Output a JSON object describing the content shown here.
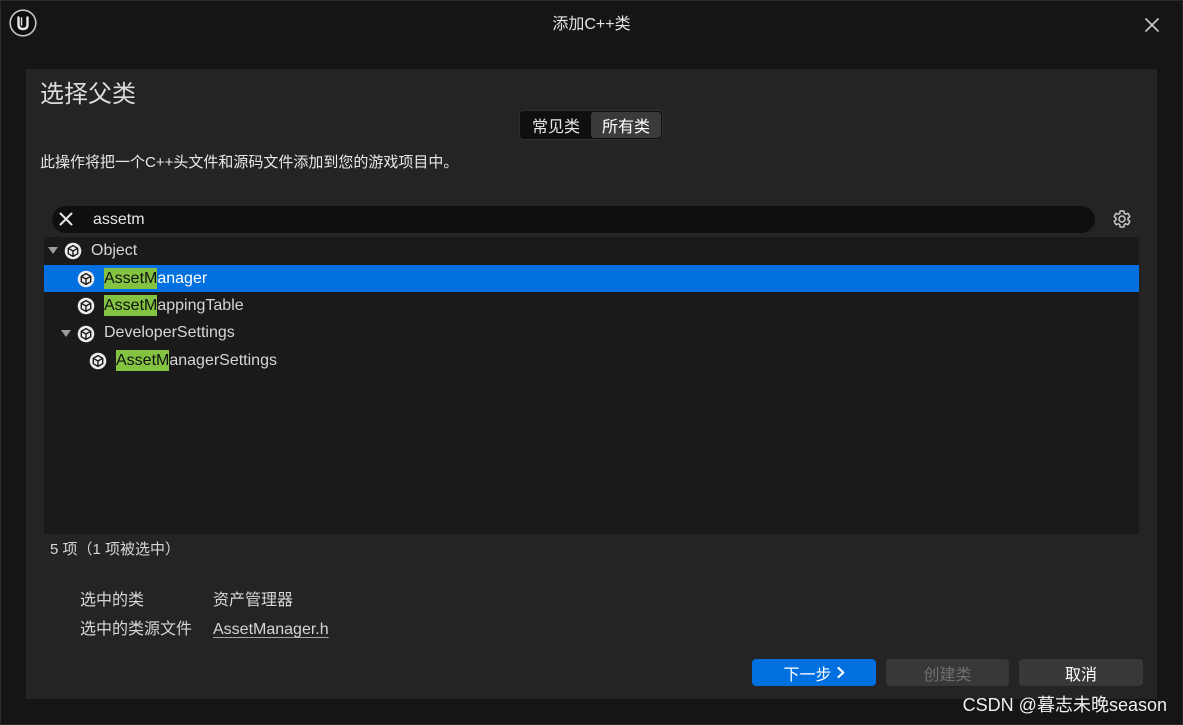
{
  "window": {
    "title": "添加C++类",
    "logo_icon": "unreal-engine-logo-icon",
    "close_icon": "close-icon"
  },
  "heading": "选择父类",
  "class_tabs": [
    {
      "label": "常见类",
      "selected": false
    },
    {
      "label": "所有类",
      "selected": true
    }
  ],
  "description": "此操作将把一个C++头文件和源码文件添加到您的游戏项目中。",
  "search": {
    "value": "assetm",
    "clear_icon": "clear-search-icon",
    "options_icon": "gear-icon"
  },
  "class_tree": [
    {
      "label": "Object",
      "icon": "class-icon",
      "expanded": true,
      "selected": false,
      "children": [
        {
          "match": "AssetM",
          "rest": "anager",
          "icon": "class-icon",
          "selected": true
        },
        {
          "match": "AssetM",
          "rest": "appingTable",
          "icon": "class-icon",
          "selected": false
        },
        {
          "label": "DeveloperSettings",
          "icon": "class-icon",
          "expanded": true,
          "selected": false,
          "children": [
            {
              "match": "AssetM",
              "rest": "anagerSettings",
              "icon": "class-icon",
              "selected": false
            }
          ]
        }
      ]
    }
  ],
  "status": "5 项（1 项被选中）",
  "selection_info": {
    "class_label": "选中的类",
    "class_value": "资产管理器",
    "source_label": "选中的类源文件",
    "source_value": "AssetManager.h"
  },
  "buttons": {
    "next_label": "下一步",
    "next_icon": "chevron-right-icon",
    "create_label": "创建类",
    "create_enabled": false,
    "cancel_label": "取消"
  },
  "watermark": "CSDN @暮志未晚season",
  "colors": {
    "accent": "#0070e0",
    "search_match_highlight": "#84c341"
  }
}
